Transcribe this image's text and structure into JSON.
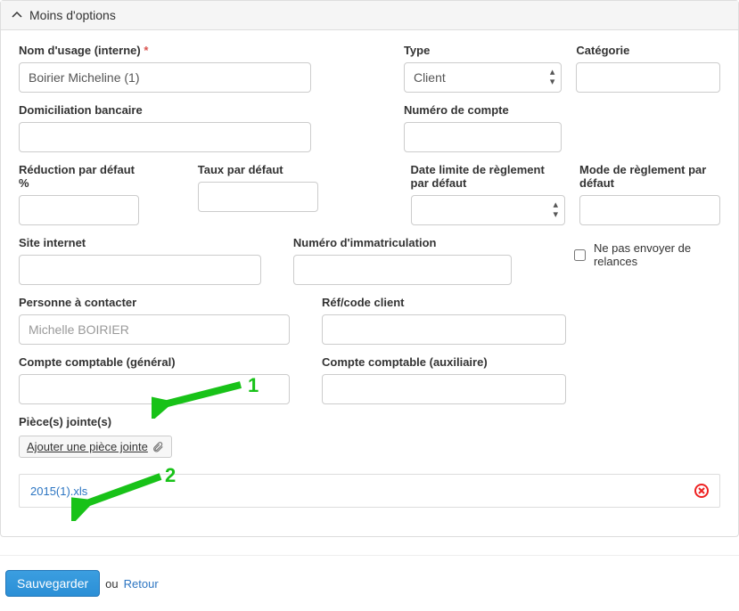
{
  "panel": {
    "title": "Moins d'options"
  },
  "labels": {
    "internal_name": "Nom d'usage (interne)",
    "type": "Type",
    "category": "Catégorie",
    "bank": "Domiciliation bancaire",
    "account_no": "Numéro de compte",
    "default_discount": "Réduction par défaut %",
    "default_rate": "Taux par défaut",
    "default_due": "Date limite de règlement par défaut",
    "default_payment": "Mode de règlement par défaut",
    "website": "Site internet",
    "registration_no": "Numéro d'immatriculation",
    "no_reminders": "Ne pas envoyer de relances",
    "contact": "Personne à contacter",
    "ref_code": "Réf/code client",
    "ledger_general": "Compte comptable (général)",
    "ledger_aux": "Compte comptable (auxiliaire)",
    "attachments": "Pièce(s) jointe(s)",
    "add_attachment": "Ajouter une pièce jointe"
  },
  "values": {
    "internal_name": "Boirier Micheline (1)",
    "type_selected": "Client",
    "contact_placeholder": "Michelle BOIRIER"
  },
  "attachments": [
    {
      "filename": "2015(1).xls"
    }
  ],
  "footer": {
    "save": "Sauvegarder",
    "or": "ou",
    "back": "Retour"
  },
  "annotations": {
    "num1": "1",
    "num2": "2"
  },
  "colors": {
    "accent": "#2b8fd6",
    "annotation": "#18c218",
    "danger": "#d9534f"
  }
}
